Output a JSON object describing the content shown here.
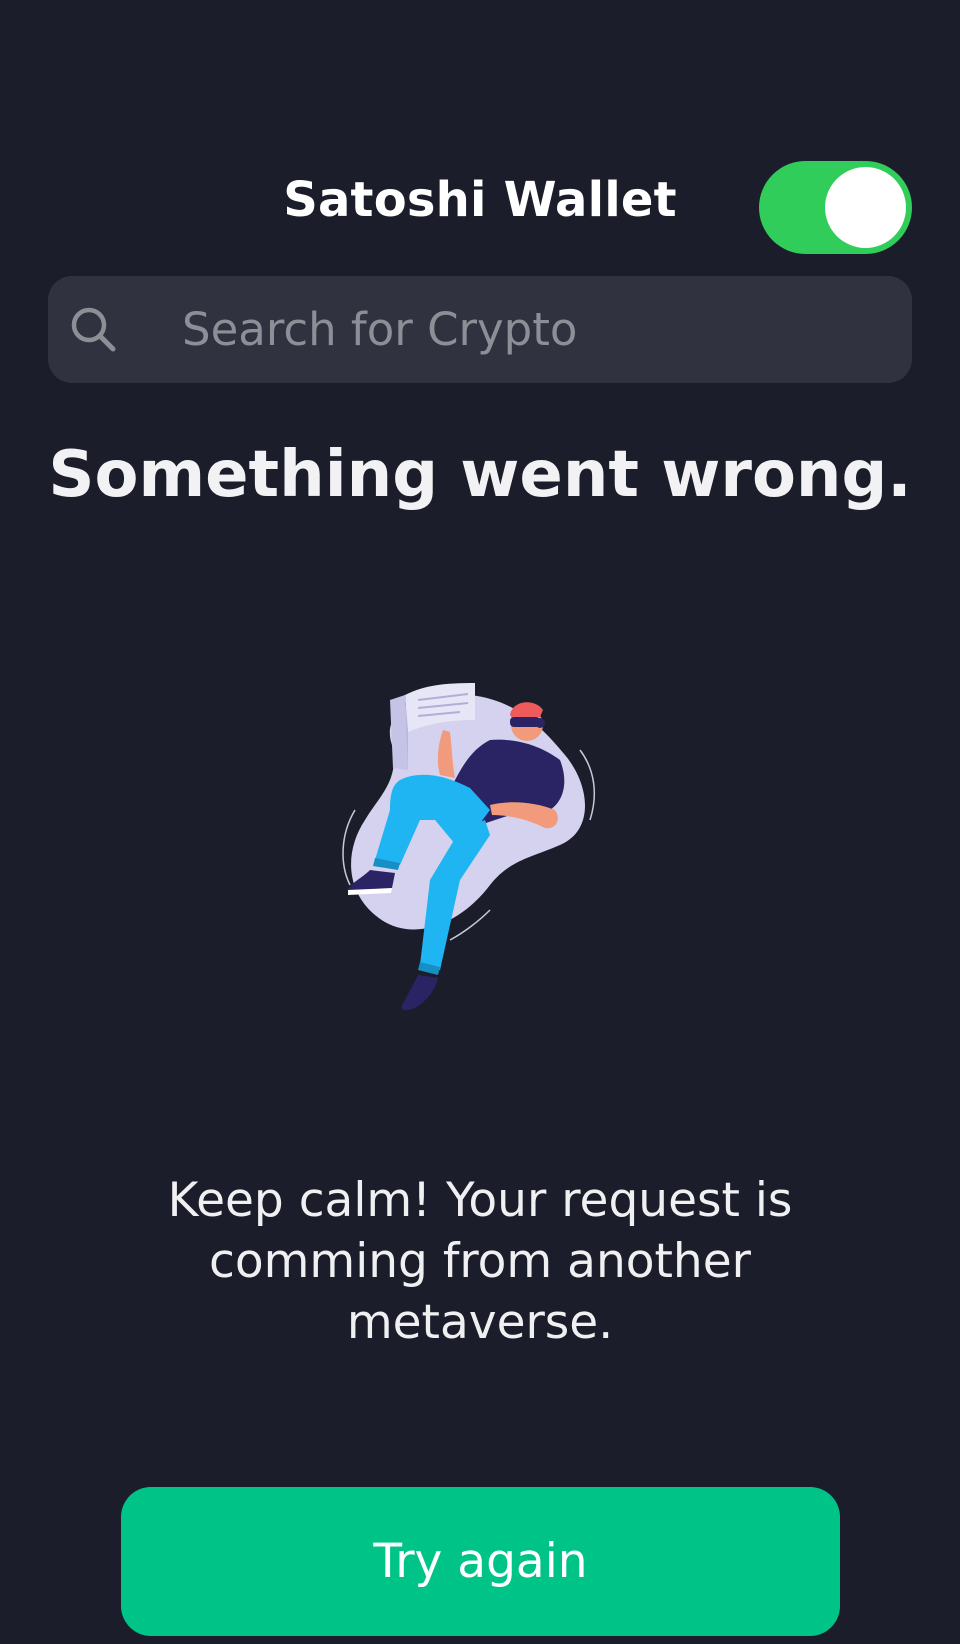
{
  "header": {
    "title": "Satoshi Wallet",
    "toggle": {
      "state": "on",
      "color": "#31cd5b"
    }
  },
  "search": {
    "placeholder": "Search for Crypto",
    "value": "",
    "icon": "search-icon"
  },
  "error": {
    "title": "Something went wrong.",
    "illustration": "person-floating-vr-illustration",
    "message": "Keep calm! Your request is comming from another metaverse."
  },
  "actions": {
    "retry_label": "Try again",
    "retry_color": "#00c487"
  },
  "theme": {
    "background": "#1b1e2a",
    "search_background": "#30323f"
  }
}
